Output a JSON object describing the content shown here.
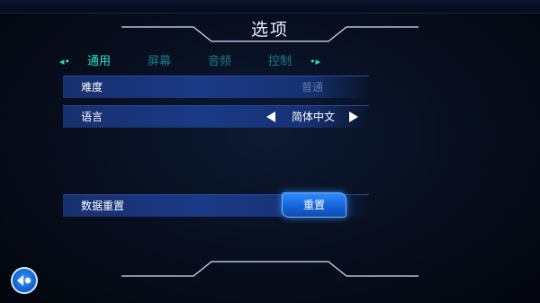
{
  "title": "选项",
  "tabs": {
    "prev_icon": "◂•",
    "next_icon": "•▸",
    "items": [
      {
        "label": "通用",
        "active": true
      },
      {
        "label": "屏幕",
        "active": false
      },
      {
        "label": "音频",
        "active": false
      },
      {
        "label": "控制",
        "active": false
      }
    ]
  },
  "settings": {
    "difficulty": {
      "label": "难度",
      "value": "普通"
    },
    "language": {
      "label": "语言",
      "value": "简体中文"
    },
    "data_reset": {
      "label": "数据重置",
      "button_label": "重置"
    }
  },
  "colors": {
    "accent_tab": "#22e6cc",
    "row_bg": "#1a3a86",
    "button_blue": "#1763d8"
  },
  "icons": {
    "back": "back-arrow-icon"
  }
}
